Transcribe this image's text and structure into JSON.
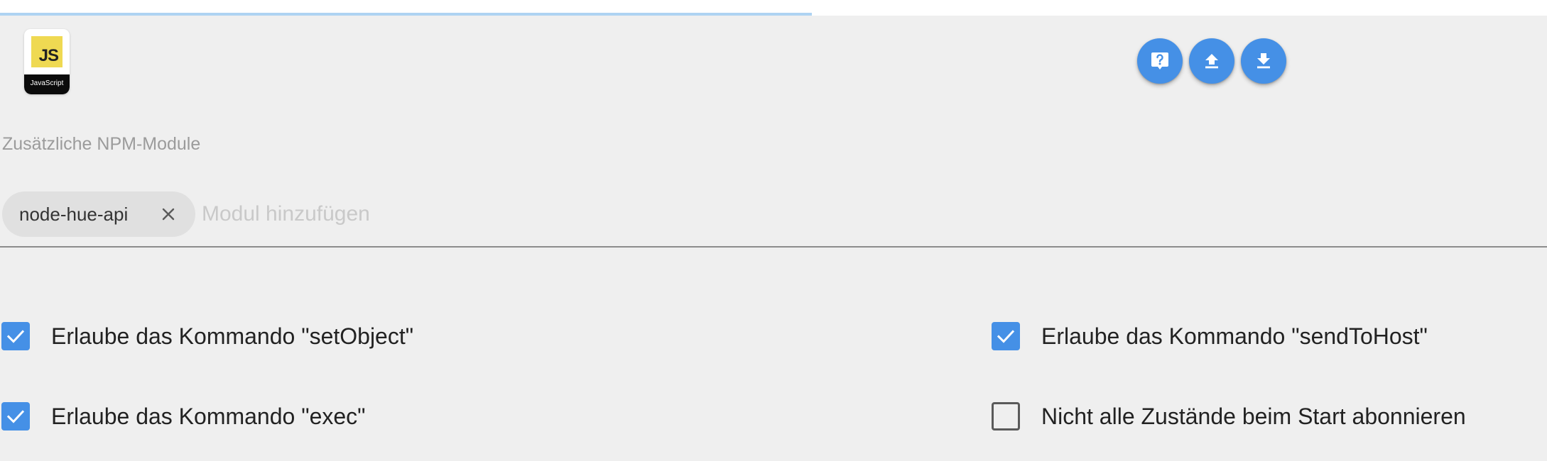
{
  "header": {
    "progress_fraction": 0.525
  },
  "logo": {
    "mark": "JS",
    "caption": "JavaScript"
  },
  "toolbar": {
    "buttons": [
      {
        "icon": "help-bubble-icon"
      },
      {
        "icon": "upload-icon"
      },
      {
        "icon": "download-icon"
      }
    ]
  },
  "npm": {
    "label": "Zusätzliche NPM-Module",
    "modules": [
      "node-hue-api"
    ],
    "input_placeholder": "Modul hinzufügen",
    "input_value": ""
  },
  "options": {
    "allow_setobject": {
      "label": "Erlaube das Kommando \"setObject\"",
      "checked": true
    },
    "allow_exec": {
      "label": "Erlaube das Kommando \"exec\"",
      "checked": true
    },
    "allow_sendtohost": {
      "label": "Erlaube das Kommando \"sendToHost\"",
      "checked": true
    },
    "no_subscribe_on_start": {
      "label": "Nicht alle Zustände beim Start abonnieren",
      "checked": false
    }
  },
  "colors": {
    "accent": "#4590e6",
    "progress": "#aed3f2",
    "background": "#efefef",
    "chip": "#e0e0e0"
  }
}
